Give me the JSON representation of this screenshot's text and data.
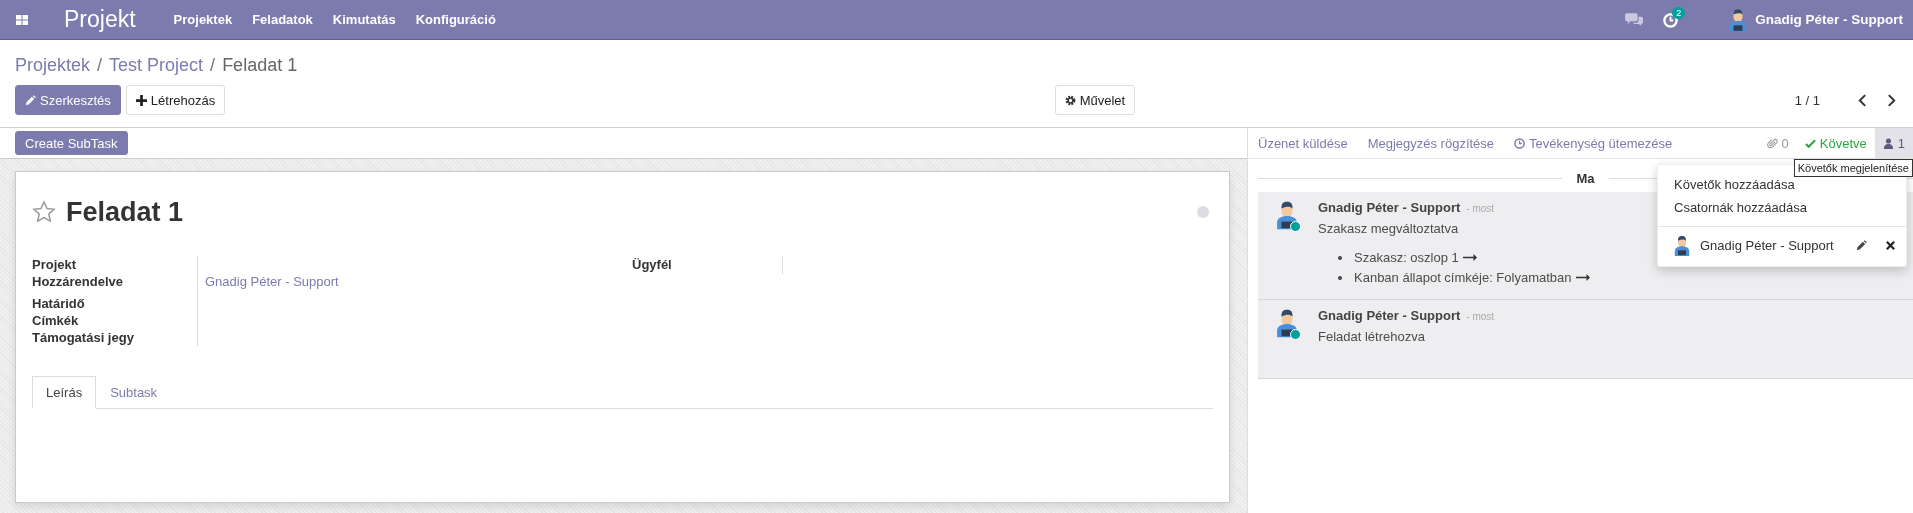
{
  "navbar": {
    "app_name": "Projekt",
    "menus": [
      "Projektek",
      "Feladatok",
      "Kimutatás",
      "Konfiguráció"
    ],
    "activity_count": "2",
    "user": "Gnadig Péter - Support"
  },
  "breadcrumbs": [
    {
      "kind": "link",
      "text": "Projektek"
    },
    {
      "kind": "separator",
      "text": "/"
    },
    {
      "kind": "link",
      "text": "Test Project"
    },
    {
      "kind": "separator",
      "text": "/"
    },
    {
      "kind": "current",
      "text": "Feladat 1"
    }
  ],
  "buttons": {
    "edit": "Szerkesztés",
    "create": "Létrehozás",
    "action": "Művelet"
  },
  "pager": "1 / 1",
  "header_buttons": [
    "Create SubTask"
  ],
  "task": {
    "title": "Feladat 1",
    "favorite": false,
    "kanban_done": false,
    "fields_left": [
      {
        "label": "Projekt"
      },
      {
        "label": "Hozzárendelve",
        "value": "Gnadig Péter - Support"
      },
      {
        "label": "Határidő"
      },
      {
        "label": "Címkék"
      },
      {
        "label": "Támogatási jegy"
      }
    ],
    "fields_right": [
      {
        "label": "Ügyfél"
      }
    ],
    "tabs": [
      {
        "label": "Leírás",
        "selected": true
      },
      {
        "label": "Subtask",
        "selected": false
      }
    ]
  },
  "chatter": {
    "actions": [
      "Üzenet küldése",
      "Megjegyzés rögzítése",
      "Tevékenység ütemezése"
    ],
    "attachments": "0",
    "follow_label": "Követve",
    "following": true,
    "followers_count": "1",
    "date_separator": "Ma",
    "messages": [
      {
        "author": "Gnadig Péter - Support",
        "time": "- most",
        "body": "Szakasz megváltoztatva",
        "online": true,
        "changes": [
          "Szakasz: oszlop 1",
          "Kanban állapot címkéje: Folyamatban"
        ]
      },
      {
        "author": "Gnadig Péter - Support",
        "time": "- most",
        "body": "Feladat létrehozva",
        "online": true
      }
    ],
    "followers_menu": {
      "items": [
        "Követők hozzáadása",
        "Csatornák hozzáadása"
      ],
      "followers": [
        {
          "name": "Gnadig Péter - Support"
        }
      ]
    },
    "tooltip": "Követők megjelenítése"
  }
}
